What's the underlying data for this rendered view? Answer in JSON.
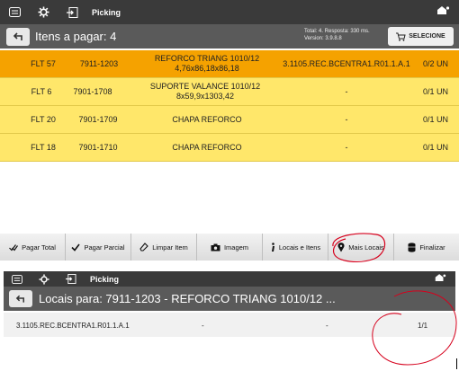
{
  "top": {
    "appbar": {
      "title": "Picking"
    },
    "header": {
      "title": "Itens a pagar: 4",
      "status_total": "Total: 4. Resposta: 330 ms.",
      "status_version": "Version: 3.9.8.8",
      "select_label": "SELECIONE"
    },
    "rows": [
      {
        "code": "FLT 57",
        "ref": "7911-1203",
        "desc1": "REFORCO TRIANG 1010/12",
        "desc2": "4,76x86,18x86,18",
        "location": "3.1105.REC.BCENTRA1.R01.1.A.1",
        "qty": "0/2 UN"
      },
      {
        "code": "FLT 6",
        "ref": "7901-1708",
        "desc1": "SUPORTE VALANCE 1010/12",
        "desc2": "8x59,9x1303,42",
        "location": "-",
        "qty": "0/1 UN"
      },
      {
        "code": "FLT 20",
        "ref": "7901-1709",
        "desc1": "CHAPA REFORCO",
        "desc2": "",
        "location": "-",
        "qty": "0/1 UN"
      },
      {
        "code": "FLT 18",
        "ref": "7901-1710",
        "desc1": "CHAPA REFORCO",
        "desc2": "",
        "location": "-",
        "qty": "0/1 UN"
      }
    ],
    "toolbar": {
      "pay_total": "Pagar Total",
      "pay_partial": "Pagar Parcial",
      "clear_item": "Limpar Item",
      "image": "Imagem",
      "locations_items": "Locais e Itens",
      "more_locations": "Mais Locais",
      "finish": "Finalizar"
    },
    "colors": {
      "selected_row": "#f5a200",
      "row": "#ffe76a",
      "annotation": "#d6001c"
    }
  },
  "bottom": {
    "appbar": {
      "title": "Picking"
    },
    "header": {
      "title": "Locais para: 7911-1203 - REFORCO TRIANG 1010/12 ..."
    },
    "row": {
      "location": "3.1105.REC.BCENTRA1.R01.1.A.1",
      "col2": "-",
      "col3": "-",
      "qty": "1/1"
    }
  }
}
